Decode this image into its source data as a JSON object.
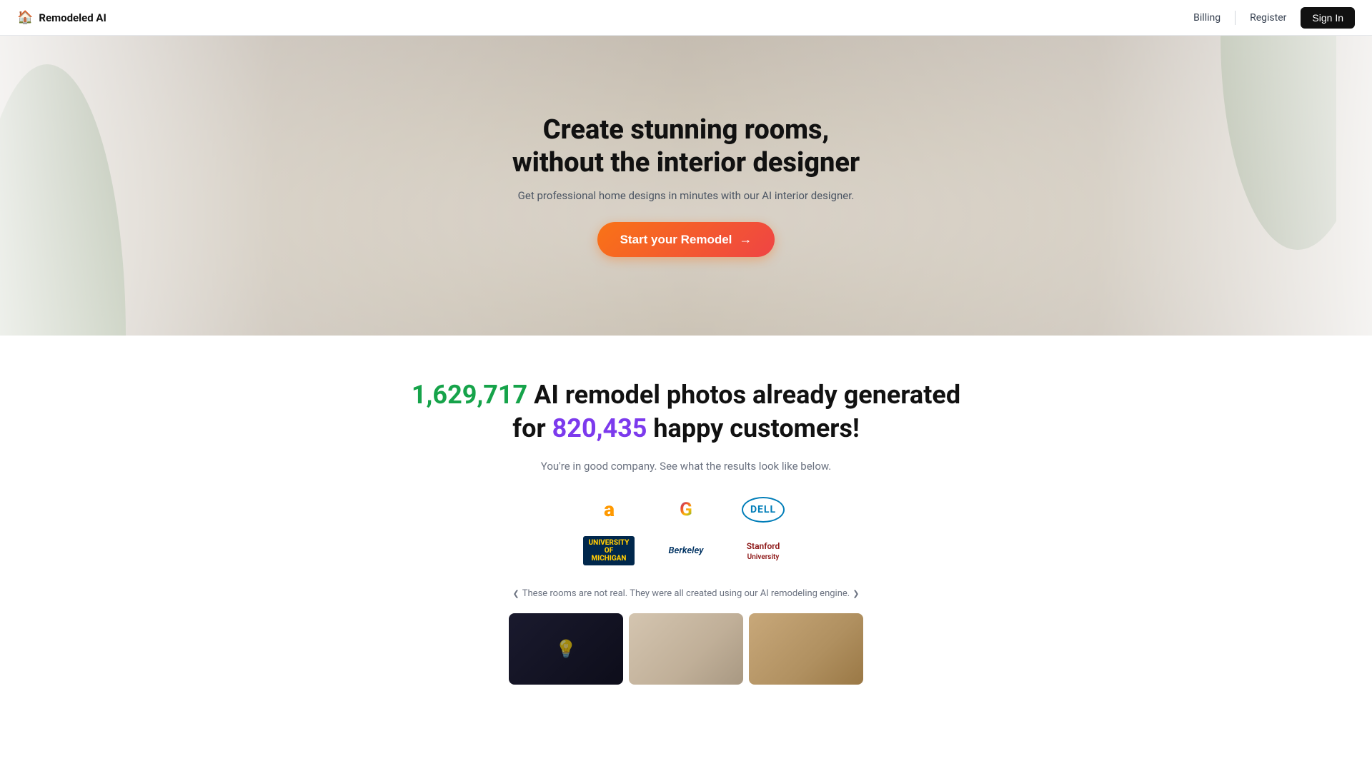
{
  "navbar": {
    "brand_name": "Remodeled AI",
    "house_icon": "🏠",
    "billing_label": "Billing",
    "register_label": "Register",
    "sign_in_label": "Sign In"
  },
  "hero": {
    "title_line1": "Create stunning rooms,",
    "title_line2": "without the interior designer",
    "subtitle": "Get professional home designs in minutes with our AI interior designer.",
    "cta_label": "Start your Remodel",
    "cta_arrow": "→"
  },
  "stats": {
    "count_photos": "1,629,717",
    "text_mid": "AI remodel photos already generated",
    "text_for": "for",
    "count_customers": "820,435",
    "text_customers": "happy customers!",
    "subtext": "You're in good company. See what the results look like below."
  },
  "logos": {
    "row1": [
      {
        "name": "Amazon",
        "type": "amazon"
      },
      {
        "name": "Google",
        "type": "google"
      },
      {
        "name": "DELL",
        "type": "dell"
      }
    ],
    "row2": [
      {
        "name": "University of Michigan",
        "type": "michigan",
        "label": "UNIVERSITY OF MICHIGAN"
      },
      {
        "name": "UC Berkeley",
        "type": "berkeley",
        "label": "Berkeley"
      },
      {
        "name": "Stanford",
        "type": "stanford",
        "label": "Stanford University"
      }
    ]
  },
  "disclaimer": {
    "chevron_left": "❮",
    "text": "These rooms are not real. They were all created using our AI remodeling engine.",
    "chevron_right": "❯"
  },
  "preview": {
    "images": [
      {
        "id": 1,
        "alt": "Dark room preview"
      },
      {
        "id": 2,
        "alt": "Light room preview"
      },
      {
        "id": 3,
        "alt": "Warm room preview"
      }
    ]
  }
}
